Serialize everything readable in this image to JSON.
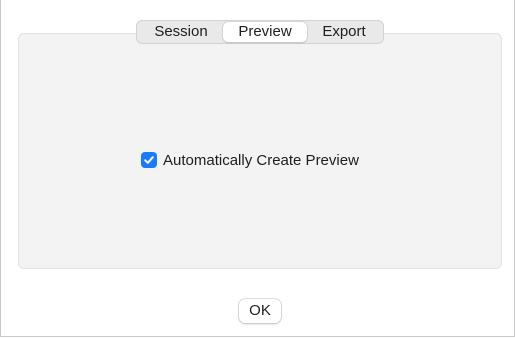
{
  "tabs": [
    {
      "label": "Session",
      "selected": false
    },
    {
      "label": "Preview",
      "selected": true
    },
    {
      "label": "Export",
      "selected": false
    }
  ],
  "preview": {
    "auto_create_label": "Automatically Create Preview",
    "auto_create_checked": true
  },
  "footer": {
    "ok_label": "OK"
  },
  "colors": {
    "accent": "#1a7af8",
    "panel_background": "#f3f3f3"
  }
}
